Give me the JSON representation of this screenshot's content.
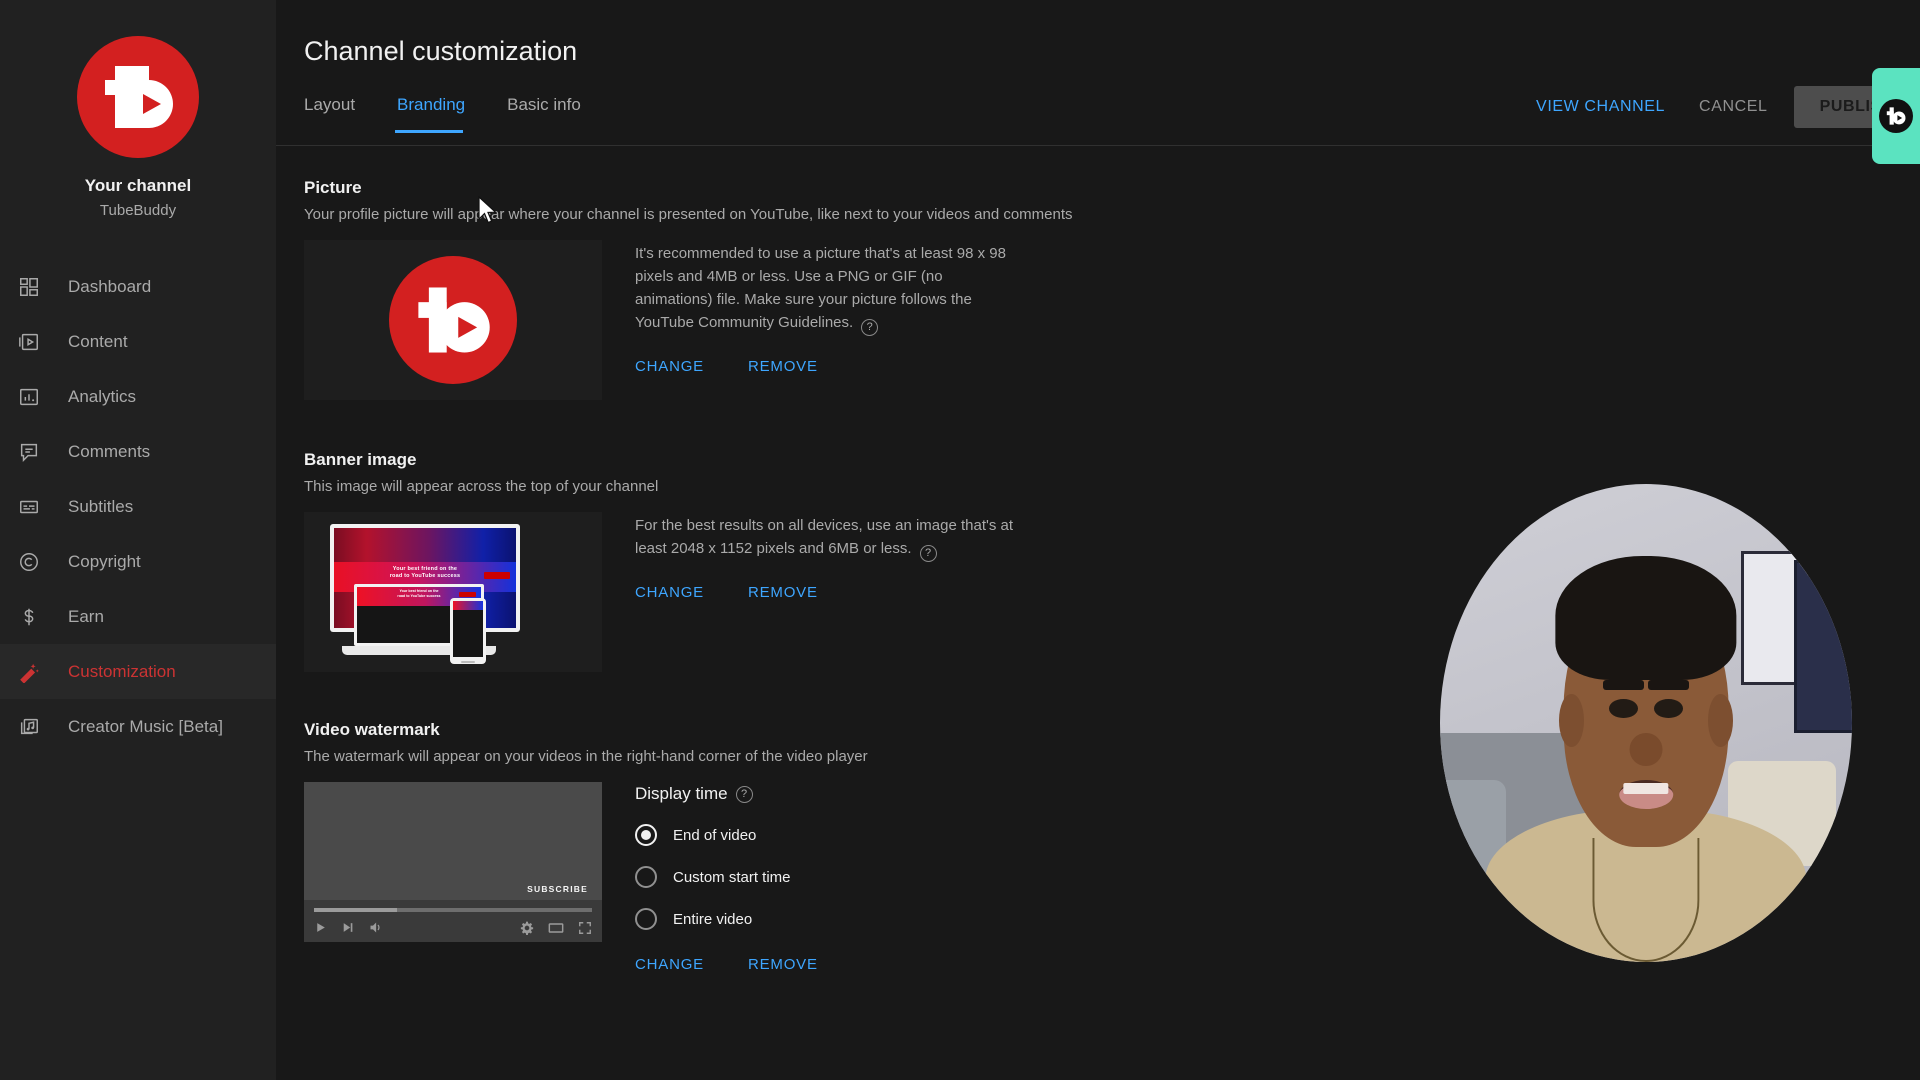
{
  "sidebar": {
    "channel": {
      "label": "Your channel",
      "name": "TubeBuddy",
      "avatar_color": "#D32020"
    },
    "items": [
      {
        "label": "Dashboard",
        "icon": "dashboard-icon",
        "active": false
      },
      {
        "label": "Content",
        "icon": "content-icon",
        "active": false
      },
      {
        "label": "Analytics",
        "icon": "analytics-icon",
        "active": false
      },
      {
        "label": "Comments",
        "icon": "comments-icon",
        "active": false
      },
      {
        "label": "Subtitles",
        "icon": "subtitles-icon",
        "active": false
      },
      {
        "label": "Copyright",
        "icon": "copyright-icon",
        "active": false
      },
      {
        "label": "Earn",
        "icon": "earn-icon",
        "active": false
      },
      {
        "label": "Customization",
        "icon": "magic-wand-icon",
        "active": true
      },
      {
        "label": "Creator Music [Beta]",
        "icon": "music-icon",
        "active": false
      }
    ]
  },
  "header": {
    "title": "Channel customization",
    "tabs": [
      {
        "label": "Layout",
        "active": false
      },
      {
        "label": "Branding",
        "active": true
      },
      {
        "label": "Basic info",
        "active": false
      }
    ],
    "view_channel_label": "VIEW CHANNEL",
    "cancel_label": "CANCEL",
    "publish_label": "PUBLISH",
    "accent_color": "#3EA6FF"
  },
  "sections": {
    "picture": {
      "title": "Picture",
      "description": "Your profile picture will appear where your channel is presented on YouTube, like next to your videos and comments",
      "info": "It's recommended to use a picture that's at least 98 x 98 pixels and 4MB or less. Use a PNG or GIF (no animations) file. Make sure your picture follows the YouTube Community Guidelines.",
      "help_icon": "?",
      "change_label": "CHANGE",
      "remove_label": "REMOVE"
    },
    "banner": {
      "title": "Banner image",
      "description": "This image will appear across the top of your channel",
      "info": "For the best results on all devices, use an image that's at least 2048 x 1152 pixels and 6MB or less.",
      "help_icon": "?",
      "change_label": "CHANGE",
      "remove_label": "REMOVE",
      "preview_text_line1": "Your best friend on the",
      "preview_text_line2": "road to YouTube success"
    },
    "watermark": {
      "title": "Video watermark",
      "description": "The watermark will appear on your videos in the right-hand corner of the video player",
      "display_time_label": "Display time",
      "help_icon": "?",
      "options": [
        {
          "label": "End of video",
          "selected": true
        },
        {
          "label": "Custom start time",
          "selected": false
        },
        {
          "label": "Entire video",
          "selected": false
        }
      ],
      "subscribe_label": "SUBSCRIBE",
      "change_label": "CHANGE",
      "remove_label": "REMOVE"
    }
  },
  "overlay": {
    "teal_panel_color": "#5BE3C0",
    "webcam": "presenter-video-circle"
  }
}
